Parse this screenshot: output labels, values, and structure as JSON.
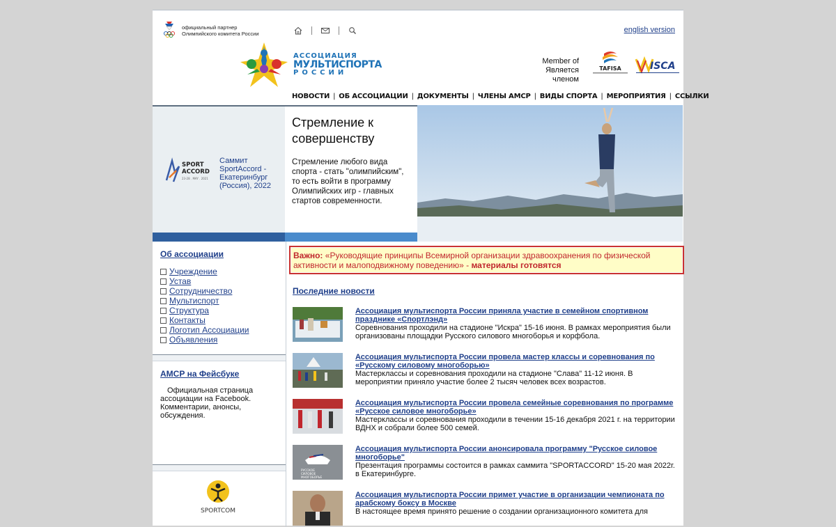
{
  "header": {
    "partner_text_line1": "официальный партнер",
    "partner_text_line2": "Олимпийского комитета России",
    "english_link": "english version",
    "logo_line1": "АССОЦИАЦИЯ",
    "logo_line2": "МУЛЬТИСПОРТА",
    "logo_line3": "РОССИИ",
    "member_line1": "Member of",
    "member_line2": "Является членом",
    "tafisa_label": "TAFISA",
    "isca_label": "ISCA",
    "icons": [
      "home-icon",
      "mail-icon",
      "search-icon"
    ]
  },
  "nav": {
    "items": [
      "НОВОСТИ",
      "ОБ АССОЦИАЦИИ",
      "ДОКУМЕНТЫ",
      "ЧЛЕНЫ АМСР",
      "ВИДЫ СПОРТА",
      "МЕРОПРИЯТИЯ",
      "ССЫЛКИ"
    ]
  },
  "banner": {
    "summit_link": "Саммит SportAccord - Екатеринбург (Россия), 2022",
    "summit_logo_text": "SPORT ACCORD",
    "summit_logo_dates": "23-28 . MAY . 2021",
    "title": "Стремление к совершенству",
    "description": "Стремление любого вида спорта - стать \"олимпийским\", то есть войти в программу Олимпийских игр - главных стартов современности."
  },
  "sidebar": {
    "about_title": "Об ассоциации",
    "items": [
      "Учреждение",
      "Устав",
      "Сотрудничество",
      "Мультиспорт",
      "Структура",
      "Контакты",
      "Логотип Ассоциации",
      "Объявления"
    ],
    "facebook_title": "АМСР на Фейсбуке",
    "facebook_text": "Официальная страница ассоциации на Facebook. Комментарии, анонсы, обсуждения.",
    "sportcom_label": "SPORTCOM"
  },
  "main": {
    "important_label": "Важно:",
    "important_text": "«Руководящие принципы Всемирной организации здравоохранения по физической активности и малоподвижному поведению» -",
    "important_status": "материалы готовятся",
    "news_heading": "Последние новости",
    "news": [
      {
        "title": "Ассоциация мультиспорта России приняла участие в семейном спортивном празднике «Спортлэнд»",
        "text": "Соревнования проходили на стадионе \"Искра\" 15-16 июня. В рамках мероприятия были организованы площадки Русского силового многоборья и корфбола."
      },
      {
        "title": "Ассоциация мультиспорта России провела мастер классы и соревнования по «Русскому силовому многоборью»",
        "text": "Мастерклассы и соревнования проходили на стадионе \"Слава\" 11-12 июня. В мероприятии приняло участие более 2 тысяч человек всех возрастов."
      },
      {
        "title": "Ассоциация мультиспорта России провела семейные соревнования по программе «Русское силовое многоборье»",
        "text": "Мастерклассы и соревнования проходили в течении 15-16 декабря 2021 г. на территории ВДНХ и собрали более 500 семей."
      },
      {
        "title": "Ассоциация мультиспорта России анонсировала программу \"Русское силовое многоборье\"",
        "text": "Презентация программы состоится в рамках саммита \"SPORTACCORD\" 15-20 мая 2022г. в Екатеринбурге.",
        "thumb_text": "РУССКОЕ СИЛОВОЕ МНОГОБОРЬЕ"
      },
      {
        "title": "Ассоциация мультиспорта России примет участие в организации чемпионата по арабскому боксу в Москве",
        "text": "В настоящее время принято решение о создании организационного комитета для"
      }
    ]
  },
  "colors": {
    "link": "#1f3f8a",
    "important_border": "#c93232",
    "important_bg": "#fffdc7",
    "banner_dark": "#2f5f9e",
    "banner_light": "#4a8bcc"
  }
}
